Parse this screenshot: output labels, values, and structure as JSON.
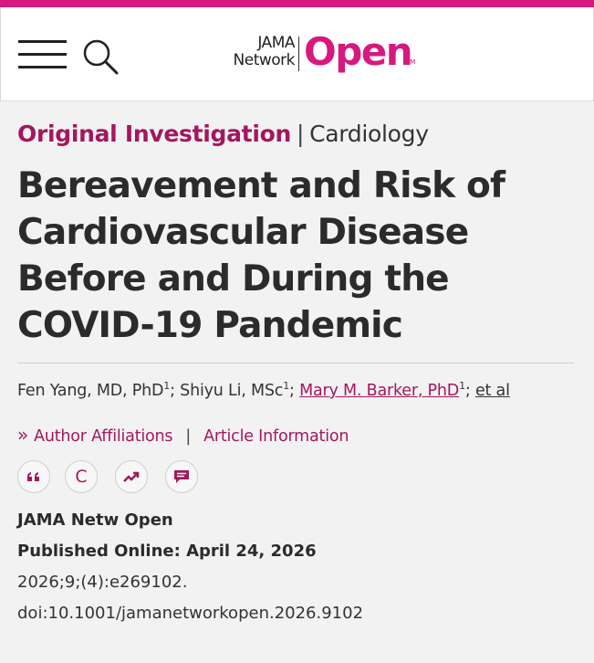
{
  "header": {
    "logo_line1": "JAMA",
    "logo_line2": "Network",
    "logo_open": "Open",
    "logo_tm": "TM",
    "accent_color": "#d6197e"
  },
  "article": {
    "type": "Original Investigation",
    "separator": "|",
    "topic": "Cardiology",
    "title": "Bereavement and Risk of Cardiovascular Disease Before and During the COVID-19 Pandemic",
    "authors": [
      {
        "name": "Fen Yang, MD, PhD",
        "sup": "1"
      },
      {
        "name": "Shiyu Li, MSc",
        "sup": "1"
      },
      {
        "name": "Mary M. Barker, PhD",
        "sup": "1"
      }
    ],
    "et_al": "et al",
    "author_affiliations": "Author Affiliations",
    "article_information": "Article Information",
    "journal": "JAMA Netw Open",
    "published": "Published Online: April 24, 2026",
    "citation": "2026;9;(4):e269102.",
    "doi": "doi:10.1001/jamanetworkopen.2026.9102"
  },
  "icons": [
    "menu-icon",
    "search-icon",
    "quote-icon",
    "permissions-icon",
    "metrics-icon",
    "comment-icon"
  ]
}
